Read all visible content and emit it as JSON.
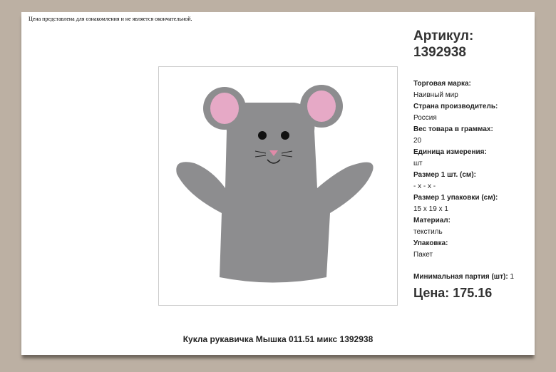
{
  "disclaimer": "Цена представлена для ознакомления и не является окончательной.",
  "article": {
    "label": "Артикул:",
    "value": "1392938"
  },
  "properties": [
    {
      "label": "Торговая марка:",
      "value": "Наивный мир"
    },
    {
      "label": "Страна производитель:",
      "value": "Россия"
    },
    {
      "label": "Вес товара в граммах:",
      "value": "20"
    },
    {
      "label": "Единица измерения:",
      "value": "шт"
    },
    {
      "label": "Размер 1 шт. (см):",
      "value": "- x - x -"
    },
    {
      "label": "Размер 1 упаковки (см):",
      "value": "15 x 19 x 1"
    },
    {
      "label": "Материал:",
      "value": "текстиль"
    },
    {
      "label": "Упаковка:",
      "value": "Пакет"
    }
  ],
  "min_batch": {
    "label": "Минимальная партия (шт):",
    "value": "1"
  },
  "price": "Цена: 175.16",
  "caption": "Кукла рукавичка Мышка 011.51  микс  1392938"
}
